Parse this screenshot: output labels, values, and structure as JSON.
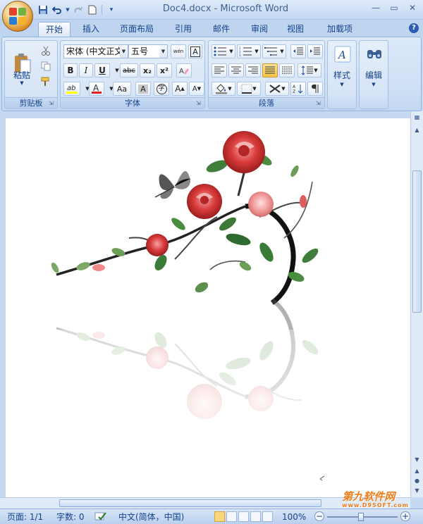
{
  "window": {
    "title": "Doc4.docx - Microsoft Word"
  },
  "quick_access": {
    "items": [
      "save-icon",
      "undo-icon",
      "redo-icon",
      "new-doc-icon"
    ]
  },
  "tabs": [
    {
      "label": "开始",
      "active": true
    },
    {
      "label": "插入"
    },
    {
      "label": "页面布局"
    },
    {
      "label": "引用"
    },
    {
      "label": "邮件"
    },
    {
      "label": "审阅"
    },
    {
      "label": "视图"
    },
    {
      "label": "加载项"
    }
  ],
  "ribbon": {
    "clipboard": {
      "label": "剪贴板",
      "paste": "粘贴"
    },
    "font": {
      "label": "字体",
      "font_name": "宋体 (中文正文",
      "font_size": "五号",
      "wen": "wén",
      "bold": "B",
      "italic": "I",
      "underline": "U",
      "strike": "abc",
      "subscript": "x₂",
      "superscript": "x²",
      "case": "Aa",
      "grow": "A",
      "shrink": "A",
      "char_border": "A",
      "phonetic": "字"
    },
    "paragraph": {
      "label": "段落"
    },
    "styles": {
      "label": "样式"
    },
    "editing": {
      "label": "编辑"
    }
  },
  "statusbar": {
    "page": "页面: 1/1",
    "words": "字数: 0",
    "language": "中文(简体，中国)",
    "zoom": "100%"
  },
  "watermark": {
    "title": "第九软件网",
    "url": "www.D9SOFT.com"
  },
  "colors": {
    "accent": "#15428b",
    "highlight": "#ffff00",
    "font_color": "#e02020",
    "rose": "#d83a3a"
  }
}
